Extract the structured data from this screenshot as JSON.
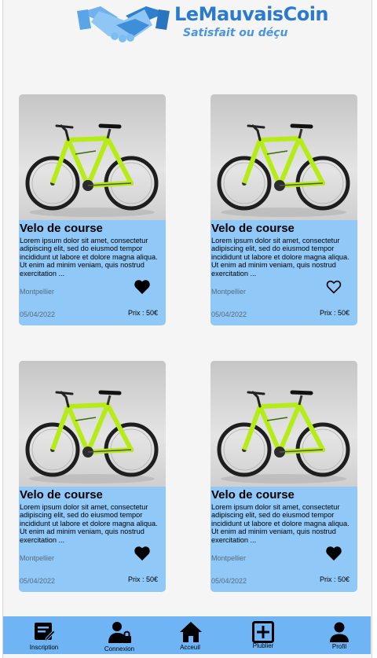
{
  "header": {
    "title": "LeMauvaisCoin",
    "tagline": "Satisfait ou déçu"
  },
  "listings": [
    {
      "title": "Velo de course",
      "description": "Lorem ipsum dolor sit amet, consectetur adipiscing elit, sed do eiusmod tempor incididunt ut labore et dolore magna aliqua. Ut enim ad minim veniam, quis nostrud exercitation  ...",
      "city": "Montpellier",
      "date": "05/04/2022",
      "price": "Prix : 50€",
      "favorite": true
    },
    {
      "title": "Velo de course",
      "description": "Lorem ipsum dolor sit amet, consectetur adipiscing elit, sed do eiusmod tempor incididunt ut labore et dolore magna aliqua. Ut enim ad minim veniam, quis nostrud exercitation  ...",
      "city": "Montpellier",
      "date": "05/04/2022",
      "price": "Prix : 50€",
      "favorite": false
    },
    {
      "title": "Velo de course",
      "description": "Lorem ipsum dolor sit amet, consectetur adipiscing elit, sed do eiusmod tempor incididunt ut labore et dolore magna aliqua. Ut enim ad minim veniam, quis nostrud exercitation  ...",
      "city": "Montpellier",
      "date": "05/04/2022",
      "price": "Prix : 50€",
      "favorite": true
    },
    {
      "title": "Velo de course",
      "description": "Lorem ipsum dolor sit amet, consectetur adipiscing elit, sed do eiusmod tempor incididunt ut labore et dolore magna aliqua. Ut enim ad minim veniam, quis nostrud exercitation  ...",
      "city": "Montpellier",
      "date": "05/04/2022",
      "price": "Prix : 50€",
      "favorite": true
    }
  ],
  "navbar": {
    "items": [
      {
        "label": "Inscription",
        "icon": "register-icon"
      },
      {
        "label": "Connexion",
        "icon": "login-lock-icon"
      },
      {
        "label": "Acceuil",
        "icon": "home-icon"
      },
      {
        "label": "Plublier",
        "icon": "add-box-icon"
      },
      {
        "label": "Profil",
        "icon": "profile-icon"
      }
    ]
  },
  "colors": {
    "brand": "#2a7ad0",
    "card_background": "#90c8f8",
    "navbar_background": "#6fb4f5"
  }
}
